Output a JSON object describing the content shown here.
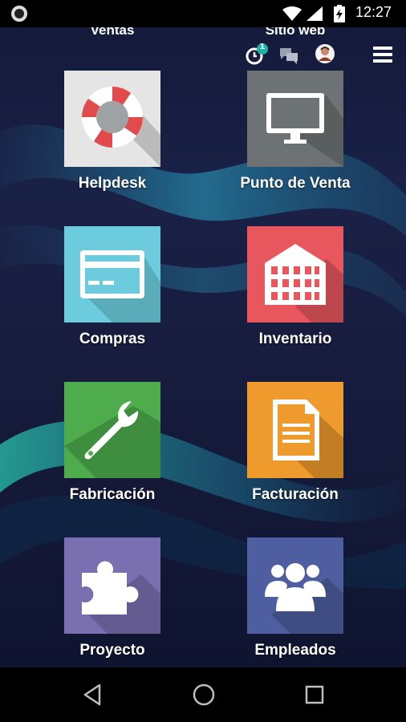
{
  "status_bar": {
    "time": "12:27",
    "icons": [
      "notification-circle-icon",
      "wifi-icon",
      "signal-icon",
      "battery-charging-icon"
    ]
  },
  "top_labels": [
    "Ventas",
    "Sitio web"
  ],
  "toolbar": {
    "activity_badge": "1",
    "icons": [
      "activity-clock-icon",
      "chat-icon",
      "user-avatar",
      "hamburger-menu-icon"
    ]
  },
  "apps": [
    {
      "label": "Helpdesk",
      "icon": "lifebuoy-icon",
      "color": "#e5e5e5"
    },
    {
      "label": "Punto de Venta",
      "icon": "monitor-icon",
      "color": "#6d7374"
    },
    {
      "label": "Compras",
      "icon": "credit-card-icon",
      "color": "#6ccbdc"
    },
    {
      "label": "Inventario",
      "icon": "building-icon",
      "color": "#e8575e"
    },
    {
      "label": "Fabricación",
      "icon": "wrench-icon",
      "color": "#4eac4d"
    },
    {
      "label": "Facturación",
      "icon": "document-icon",
      "color": "#ee9a2d"
    },
    {
      "label": "Proyecto",
      "icon": "puzzle-icon",
      "color": "#7a6fb0"
    },
    {
      "label": "Empleados",
      "icon": "people-icon",
      "color": "#4f5ea0"
    }
  ],
  "nav_bar": {
    "icons": [
      "back-icon",
      "home-icon",
      "recents-icon"
    ]
  }
}
